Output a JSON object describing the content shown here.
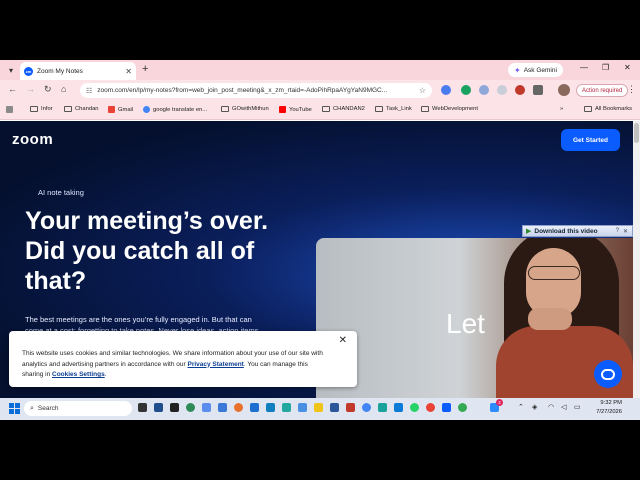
{
  "browser": {
    "tab": {
      "title": "Zoom My Notes",
      "favicon": "zoom"
    },
    "gemini_label": "Ask Gemini",
    "url": "zoom.com/en/lp/my-notes?from=web_join_post_meeting&_x_zm_rtaid=-AdoPihRpaAYgYaN9MGC...",
    "action_required": "Action required",
    "all_bookmarks": "All Bookmarks",
    "bookmarks": [
      {
        "label": "Infor",
        "icon": "folder-icon"
      },
      {
        "label": "Chandan",
        "icon": "folder-icon"
      },
      {
        "label": "Gmail",
        "icon": "gmail-icon"
      },
      {
        "label": "google translate en...",
        "icon": "google-icon"
      },
      {
        "label": "GOwithMithun",
        "icon": "folder-icon"
      },
      {
        "label": "YouTube",
        "icon": "youtube-icon"
      },
      {
        "label": "CHANDAN2",
        "icon": "folder-icon"
      },
      {
        "label": "Task_Link",
        "icon": "folder-icon"
      },
      {
        "label": "WebDevelopment",
        "icon": "folder-icon"
      }
    ]
  },
  "page": {
    "logo": "zoom",
    "cta": "Get Started",
    "eyebrow": "AI note taking",
    "headline": "Your meeting’s over. Did you catch all of that?",
    "lead_line1": "The best meetings are the ones you’re fully engaged in. But that can",
    "lead_line2": "come at a cost: forgetting to take notes. Never lose ideas, action items,",
    "hero_text": "Let",
    "download_bar": "Download this video",
    "cookie": {
      "text1": "This website uses cookies and similar technologies. We share information about your use of our site with analytics and advertising partners in accordance with our ",
      "privacy_link": "Privacy Statement",
      "text2": ". You can manage this sharing in ",
      "settings_link": "Cookies Settings",
      "text3": "."
    }
  },
  "taskbar": {
    "search_placeholder": "Search",
    "time": "9:32 PM",
    "date": "7/27/2026",
    "notif_count": "2"
  },
  "colors": {
    "accent": "#0b5cff",
    "tab_strip": "#f9d6dc",
    "page_bg": "#0a1e5a"
  }
}
